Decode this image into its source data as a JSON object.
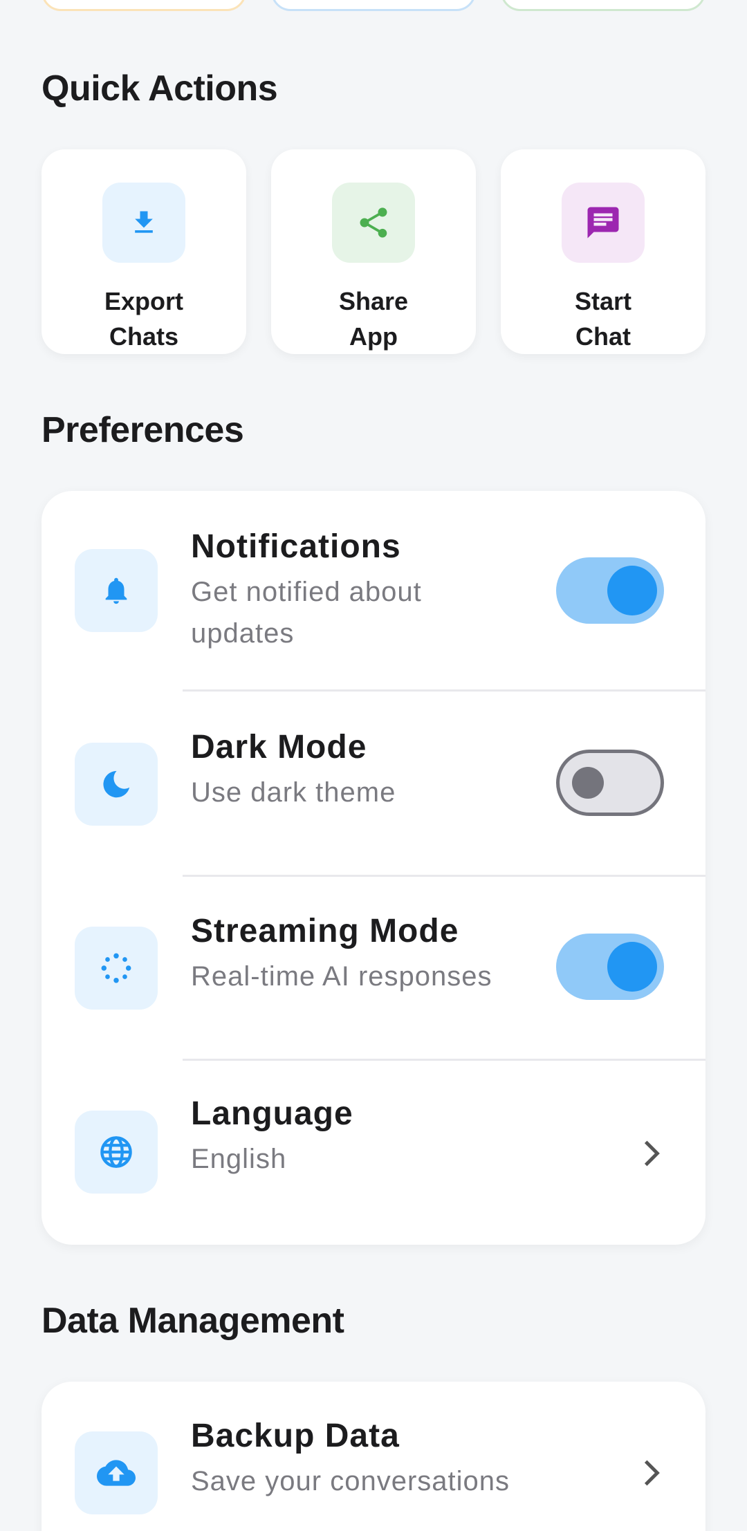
{
  "top_cards": [
    {
      "border": "#fbe3b8"
    },
    {
      "border": "#c7e1f8"
    },
    {
      "border": "#cfe8cf"
    }
  ],
  "quick_actions": {
    "title": "Quick Actions",
    "items": [
      {
        "label": "Export\nChats",
        "icon": "download-icon",
        "bg": "#e6f3fe",
        "color": "#2196f3"
      },
      {
        "label": "Share\nApp",
        "icon": "share-icon",
        "bg": "#e6f4e7",
        "color": "#4caf50"
      },
      {
        "label": "Start\nChat",
        "icon": "chat-icon",
        "bg": "#f5e7f7",
        "color": "#9c27b0"
      }
    ]
  },
  "preferences": {
    "title": "Preferences",
    "items": [
      {
        "title": "Notifications",
        "subtitle": "Get notified about\nupdates",
        "icon": "bell-icon",
        "control": "toggle",
        "on": true
      },
      {
        "title": "Dark Mode",
        "subtitle": "Use dark theme",
        "icon": "moon-icon",
        "control": "toggle",
        "on": false
      },
      {
        "title": "Streaming Mode",
        "subtitle": "Real-time AI responses",
        "icon": "streaming-icon",
        "control": "toggle",
        "on": true
      },
      {
        "title": "Language",
        "subtitle": "English",
        "icon": "globe-icon",
        "control": "chevron"
      }
    ]
  },
  "data_management": {
    "title": "Data Management",
    "items": [
      {
        "title": "Backup Data",
        "subtitle": "Save your conversations",
        "icon": "cloud-upload-icon",
        "control": "chevron"
      }
    ]
  },
  "colors": {
    "accent": "#2196f3",
    "toggle_track_on": "#90c9f8",
    "toggle_off": "#74747c"
  }
}
